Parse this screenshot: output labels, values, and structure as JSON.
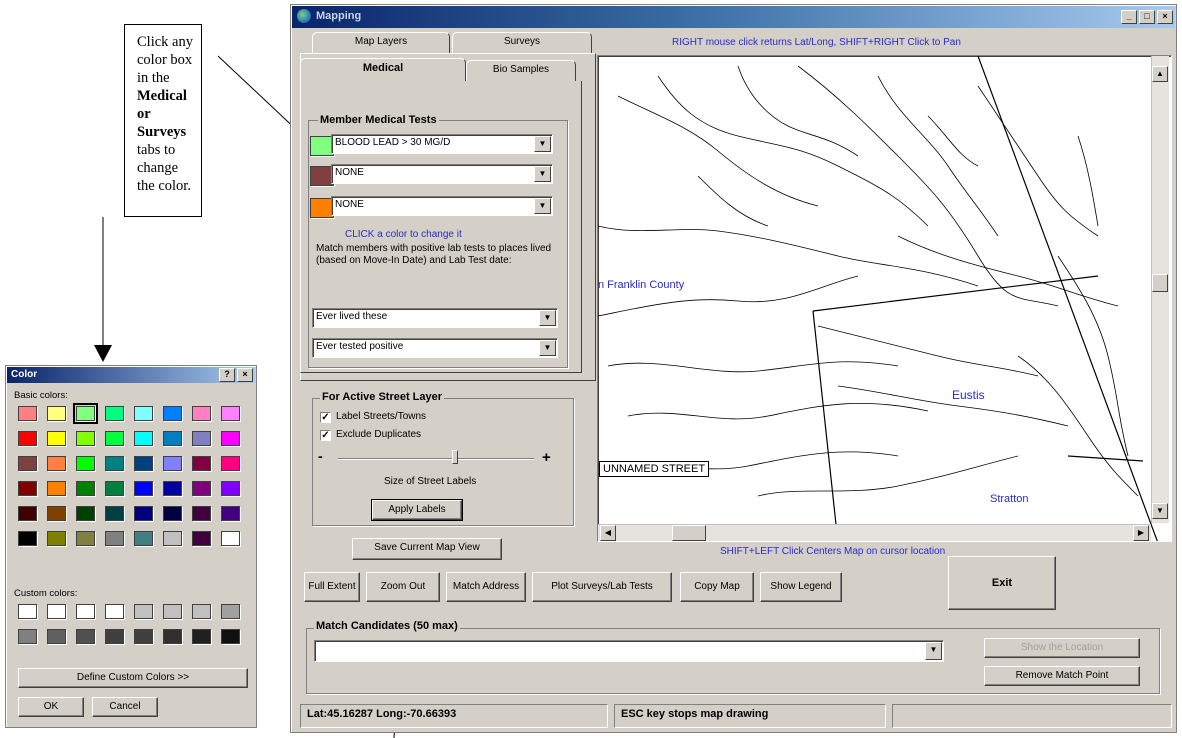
{
  "callout": {
    "line1": "Click any color box in the",
    "bold": "Medical or Surveys",
    "line3": "tabs to change the color."
  },
  "color_dialog": {
    "title": "Color",
    "help_btn": "?",
    "close_btn": "×",
    "basic_label": "Basic colors:",
    "custom_label": "Custom colors:",
    "define_btn": "Define Custom Colors >>",
    "ok_btn": "OK",
    "cancel_btn": "Cancel",
    "basic_colors": [
      "#ff8080",
      "#ffff80",
      "#80ff80",
      "#00ff80",
      "#80ffff",
      "#0080ff",
      "#ff80c0",
      "#ff80ff",
      "#ff0000",
      "#ffff00",
      "#80ff00",
      "#00ff40",
      "#00ffff",
      "#0080c0",
      "#8080c0",
      "#ff00ff",
      "#804040",
      "#ff8040",
      "#00ff00",
      "#008080",
      "#004080",
      "#8080ff",
      "#800040",
      "#ff0080",
      "#800000",
      "#ff8000",
      "#008000",
      "#008040",
      "#0000ff",
      "#0000a0",
      "#800080",
      "#8000ff",
      "#400000",
      "#804000",
      "#004000",
      "#004040",
      "#000080",
      "#000040",
      "#400040",
      "#400080",
      "#000000",
      "#808000",
      "#808040",
      "#808080",
      "#408080",
      "#c0c0c0",
      "#400040",
      "#ffffff"
    ],
    "custom_colors": [
      "#ffffff",
      "#ffffff",
      "#ffffff",
      "#ffffff",
      "#c0c0c0",
      "#c0c0c0",
      "#c0c0c0",
      "#a0a0a0",
      "#808080",
      "#606060",
      "#505050",
      "#404040",
      "#404040",
      "#303030",
      "#202020",
      "#101010"
    ]
  },
  "main": {
    "title": "Mapping",
    "min_btn": "_",
    "max_btn": "□",
    "close_btn": "×",
    "hint_top": "RIGHT mouse click returns Lat/Long, SHIFT+RIGHT Click to Pan",
    "hint_bottom": "SHIFT+LEFT Click Centers Map on cursor location",
    "tabs_back": [
      "Map Layers",
      "Surveys"
    ],
    "tabs_front": [
      "Medical",
      "Bio Samples"
    ],
    "medical": {
      "group_title": "Member Medical Tests",
      "tests": [
        {
          "color": "#80ff80",
          "value": "BLOOD LEAD > 30 MG/D"
        },
        {
          "color": "#804040",
          "value": "NONE"
        },
        {
          "color": "#ff8000",
          "value": "NONE"
        }
      ],
      "click_hint": "CLICK a color to change it",
      "match_text": "Match members with positive lab tests to places lived (based on Move-In Date) and Lab Test date:",
      "lived_select": "Ever lived these",
      "tested_select": "Ever tested positive"
    },
    "street": {
      "group_title": "For Active Street Layer",
      "label_streets": "Label Streets/Towns",
      "exclude_dupes": "Exclude Duplicates",
      "minus": "-",
      "plus": "+",
      "size_label": "Size of Street Labels",
      "apply_btn": "Apply Labels",
      "check_mark": "✓"
    },
    "save_view_btn": "Save Current Map View",
    "buttons": [
      "Full Extent",
      "Zoom Out",
      "Match Address",
      "Plot Surveys/Lab Tests",
      "Copy Map",
      "Show Legend"
    ],
    "exit_btn": "Exit",
    "match": {
      "title": "Match Candidates (50 max)",
      "value": "",
      "show_loc_btn": "Show the Location",
      "remove_btn": "Remove Match Point"
    },
    "status": {
      "coords": "Lat:45.16287 Long:-70.66393",
      "esc": "ESC key stops map drawing"
    },
    "map": {
      "county_label": "n Franklin County",
      "town_label": "Eustis",
      "town2_label": "Stratton",
      "tooltip": "UNNAMED STREET"
    }
  }
}
